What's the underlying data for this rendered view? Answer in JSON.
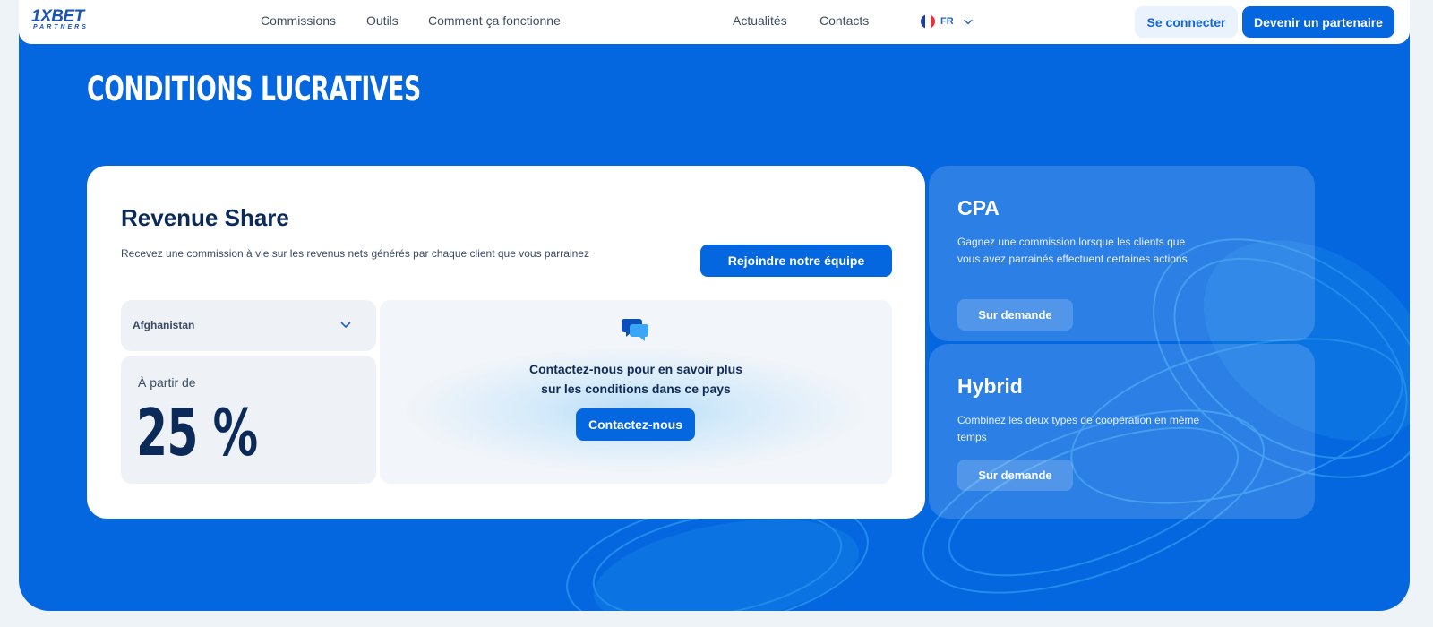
{
  "header": {
    "logo_main": "1XBET",
    "logo_sub": "PARTNERS",
    "nav": [
      {
        "label": "Commissions"
      },
      {
        "label": "Outils"
      },
      {
        "label": "Comment ça fonctionne"
      },
      {
        "label": "Actualités"
      },
      {
        "label": "Contacts"
      }
    ],
    "language": {
      "label": "FR",
      "icon": "france-flag-icon"
    },
    "login_label": "Se connecter",
    "partner_label": "Devenir un partenaire"
  },
  "section": {
    "title": "CONDITIONS LUCRATIVES"
  },
  "revenue_share": {
    "title": "Revenue Share",
    "description": "Recevez une commission à vie sur les revenus nets générés par chaque client que vous parrainez",
    "join_label": "Rejoindre notre équipe",
    "country": {
      "selected": "Afghanistan"
    },
    "rate_label": "À partir de",
    "rate_value": "25 %",
    "contact_line1": "Contactez-nous pour en savoir plus",
    "contact_line2": "sur les conditions dans ce pays",
    "contact_label": "Contactez-nous"
  },
  "cpa": {
    "title": "CPA",
    "description": "Gagnez une commission lorsque les clients que vous avez parrainés effectuent certaines actions",
    "button_label": "Sur demande"
  },
  "hybrid": {
    "title": "Hybrid",
    "description": "Combinez les deux types de coopération en même temps",
    "button_label": "Sur demande"
  },
  "colors": {
    "brand_blue": "#0467e0",
    "dark_navy": "#0c2a58",
    "panel_grey": "#eef2f7"
  }
}
